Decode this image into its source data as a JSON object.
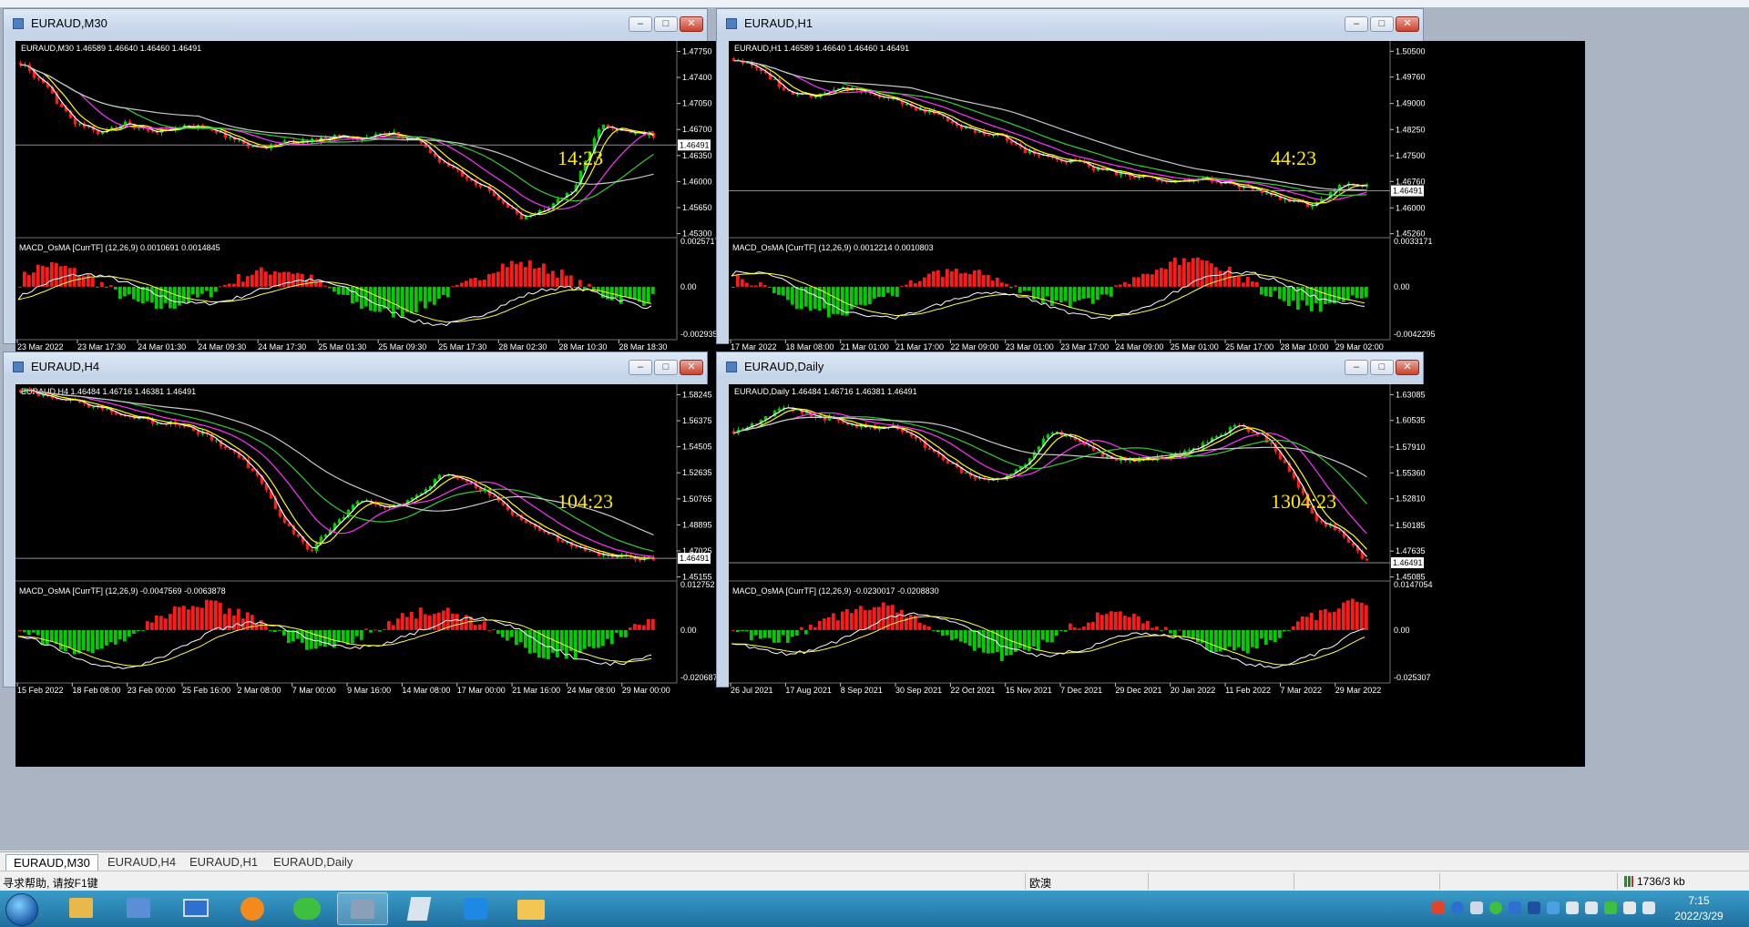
{
  "windows": [
    {
      "id": "m30",
      "title": "EURAUD,M30",
      "info": "EURAUD,M30  1.46589 1.46640 1.46460 1.46491",
      "timer": "14:23",
      "price_ticks": [
        "1.47750",
        "1.47400",
        "1.47050",
        "1.46700",
        "1.46350",
        "1.46000",
        "1.45650",
        "1.45300"
      ],
      "current_price": "1.46491",
      "indicator_label": "MACD_OsMA [CurrTF] (12,26,9) 0.0010691 0.0014845",
      "indicator_ticks": [
        "0.0025717",
        "0.00",
        "-0.0029355"
      ],
      "time_ticks": [
        "23 Mar 2022",
        "23 Mar 17:30",
        "24 Mar 01:30",
        "24 Mar 09:30",
        "24 Mar 17:30",
        "25 Mar 01:30",
        "25 Mar 09:30",
        "25 Mar 17:30",
        "28 Mar 02:30",
        "28 Mar 10:30",
        "28 Mar 18:30"
      ],
      "series_points": [
        1.476,
        1.4725,
        1.468,
        1.4665,
        1.4678,
        1.4668,
        1.4672,
        1.4675,
        1.4658,
        1.4645,
        1.4652,
        1.4655,
        1.4662,
        1.4658,
        1.4665,
        1.4655,
        1.4625,
        1.4605,
        1.4582,
        1.455,
        1.4565,
        1.459,
        1.468,
        1.4665,
        1.4662
      ]
    },
    {
      "id": "h1",
      "title": "EURAUD,H1",
      "info": "EURAUD,H1  1.46589 1.46640 1.46460 1.46491",
      "timer": "44:23",
      "price_ticks": [
        "1.50500",
        "1.49760",
        "1.49000",
        "1.48250",
        "1.47500",
        "1.46760",
        "1.46000",
        "1.45260"
      ],
      "current_price": "1.46491",
      "indicator_label": "MACD_OsMA [CurrTF] (12,26,9) 0.0012214 0.0010803",
      "indicator_ticks": [
        "0.0033171",
        "0.00",
        "-0.0042295"
      ],
      "time_ticks": [
        "17 Mar 2022",
        "18 Mar 08:00",
        "21 Mar 01:00",
        "21 Mar 17:00",
        "22 Mar 09:00",
        "23 Mar 01:00",
        "23 Mar 17:00",
        "24 Mar 09:00",
        "25 Mar 01:00",
        "25 Mar 17:00",
        "28 Mar 10:00",
        "29 Mar 02:00"
      ],
      "series_points": [
        1.503,
        1.5,
        1.4935,
        1.4915,
        1.495,
        1.493,
        1.491,
        1.4885,
        1.486,
        1.482,
        1.481,
        1.4765,
        1.4745,
        1.473,
        1.4705,
        1.4695,
        1.4685,
        1.4675,
        1.468,
        1.4665,
        1.4645,
        1.462,
        1.4605,
        1.4665,
        1.4665
      ]
    },
    {
      "id": "h4",
      "title": "EURAUD,H4",
      "info": "EURAUD,H4  1.46484 1.46716 1.46381 1.46491",
      "timer": "104:23",
      "price_ticks": [
        "1.58245",
        "1.56375",
        "1.54505",
        "1.52635",
        "1.50765",
        "1.48895",
        "1.47025",
        "1.45155"
      ],
      "current_price": "1.46491",
      "indicator_label": "MACD_OsMA [CurrTF] (12,26,9) -0.0047569 -0.0063878",
      "indicator_ticks": [
        "0.012752",
        "0.00",
        "-0.020687"
      ],
      "time_ticks": [
        "15 Feb 2022",
        "18 Feb 08:00",
        "23 Feb 00:00",
        "25 Feb 16:00",
        "2 Mar 08:00",
        "7 Mar 00:00",
        "9 Mar 16:00",
        "14 Mar 08:00",
        "17 Mar 00:00",
        "21 Mar 16:00",
        "24 Mar 08:00",
        "29 Mar 00:00"
      ],
      "series_points": [
        1.586,
        1.582,
        1.5775,
        1.573,
        1.568,
        1.563,
        1.561,
        1.554,
        1.542,
        1.525,
        1.49,
        1.47,
        1.492,
        1.508,
        1.5,
        1.51,
        1.5255,
        1.52,
        1.508,
        1.492,
        1.482,
        1.474,
        1.468,
        1.466,
        1.465
      ]
    },
    {
      "id": "daily",
      "title": "EURAUD,Daily",
      "info": "EURAUD,Daily  1.46484 1.46716 1.46381 1.46491",
      "timer": "1304:23",
      "price_ticks": [
        "1.63085",
        "1.60535",
        "1.57910",
        "1.55360",
        "1.52810",
        "1.50185",
        "1.47635",
        "1.45085"
      ],
      "current_price": "1.46491",
      "indicator_label": "MACD_OsMA [CurrTF] (12,26,9) -0.0230017 -0.0208830",
      "indicator_ticks": [
        "0.0147054",
        "0.00",
        "-0.025307"
      ],
      "time_ticks": [
        "26 Jul 2021",
        "17 Aug 2021",
        "8 Sep 2021",
        "30 Sep 2021",
        "22 Oct 2021",
        "15 Nov 2021",
        "7 Dec 2021",
        "29 Dec 2021",
        "20 Jan 2022",
        "11 Feb 2022",
        "7 Mar 2022",
        "29 Mar 2022"
      ],
      "series_points": [
        1.595,
        1.605,
        1.62,
        1.61,
        1.605,
        1.598,
        1.6,
        1.585,
        1.565,
        1.55,
        1.548,
        1.56,
        1.595,
        1.585,
        1.57,
        1.565,
        1.568,
        1.572,
        1.585,
        1.6,
        1.592,
        1.56,
        1.51,
        1.495,
        1.466
      ]
    }
  ],
  "tabs": [
    "EURAUD,M30",
    "EURAUD,H4",
    "EURAUD,H1",
    "EURAUD,Daily"
  ],
  "status": {
    "help": "寻求帮助, 请按F1键",
    "profile": "欧澳",
    "traffic": "1736/3 kb"
  },
  "taskbar": {
    "time": "7:15",
    "date": "2022/3/29"
  },
  "colors": {
    "bull": "#00cc00",
    "bear": "#ff1a1a",
    "ma_fast": "#ffffff",
    "ma_2": "#ffff00",
    "ma_3": "#ff33ff",
    "ma_4": "#33cc33",
    "ma_slow": "#c8c8c8",
    "timer": "#ffea00",
    "signal": "#ffff40"
  }
}
